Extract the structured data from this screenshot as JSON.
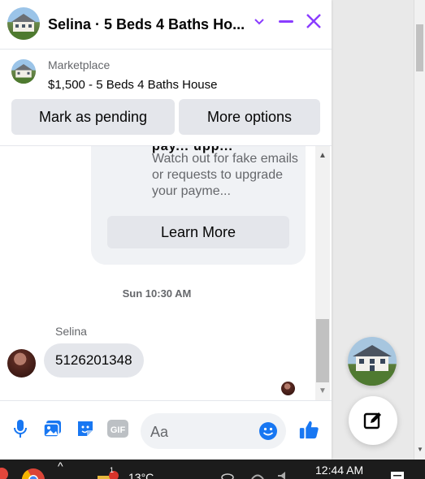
{
  "header": {
    "title": "Selina · 5 Beds 4 Baths Ho...",
    "chevron_icon": "chevron-down-icon",
    "minimize_icon": "minimize-icon",
    "close_icon": "close-icon",
    "accent": "#8a3cff"
  },
  "listing": {
    "source": "Marketplace",
    "title": "$1,500 - 5 Beds 4 Baths House",
    "buttons": [
      "Mark as pending",
      "More options"
    ]
  },
  "messages": {
    "card_heading_partial": "pay... upp...",
    "card_text": "Watch out for fake emails or requests to upgrade your payme...",
    "card_button": "Learn More",
    "timestamp": "Sun 10:30 AM",
    "sender": "Selina",
    "message": "5126201348"
  },
  "composer": {
    "placeholder": "Aa",
    "icons": [
      "microphone-icon",
      "photo-icon",
      "sticker-icon",
      "gif-icon",
      "emoji-icon",
      "thumbs-up-icon"
    ],
    "accent": "#1877f2"
  },
  "taskbar": {
    "weather": "13°C",
    "time": "12:44 AM",
    "badge": "1"
  }
}
